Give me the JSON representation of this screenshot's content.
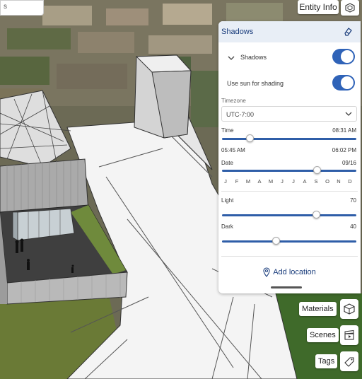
{
  "search": {
    "value": "s"
  },
  "topbar": {
    "entity_info_label": "Entity Info"
  },
  "shadows_panel": {
    "title": "Shadows",
    "shadows_toggle_label": "Shadows",
    "shadows_on": true,
    "use_sun_label": "Use sun for shading",
    "use_sun_on": true,
    "timezone_label": "Timezone",
    "timezone_value": "UTC-7:00",
    "time_label": "Time",
    "time_value": "08:31 AM",
    "time_fraction": 0.21,
    "sunrise": "05:45 AM",
    "sunset": "06:02 PM",
    "date_label": "Date",
    "date_value": "09/16",
    "date_fraction": 0.71,
    "months": [
      "J",
      "F",
      "M",
      "A",
      "M",
      "J",
      "J",
      "A",
      "S",
      "O",
      "N",
      "D"
    ],
    "light_label": "Light",
    "light_value": "70",
    "light_fraction": 0.7,
    "dark_label": "Dark",
    "dark_value": "40",
    "dark_fraction": 0.4,
    "add_location_label": "Add location"
  },
  "tools": {
    "materials_label": "Materials",
    "scenes_label": "Scenes",
    "tags_label": "Tags"
  },
  "colors": {
    "accent": "#2f63b8",
    "title_blue": "#1a3d7c",
    "header_bg": "#e8eef6"
  }
}
